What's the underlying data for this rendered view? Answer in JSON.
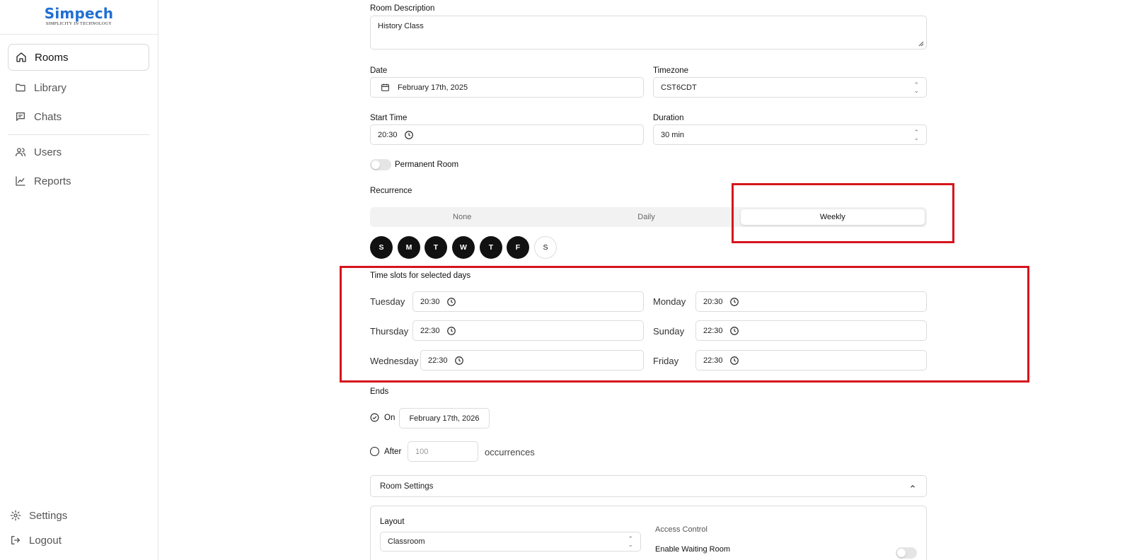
{
  "brand": {
    "name": "Simpech",
    "tagline": "SIMPLICITY IN TECHNOLOGY"
  },
  "sidebar": {
    "items": [
      {
        "label": "Rooms",
        "icon": "home-icon",
        "active": true
      },
      {
        "label": "Library",
        "icon": "folder-icon"
      },
      {
        "label": "Chats",
        "icon": "chat-icon"
      },
      {
        "label": "Users",
        "icon": "users-icon"
      },
      {
        "label": "Reports",
        "icon": "chart-line-icon"
      }
    ],
    "bottom": [
      {
        "label": "Settings",
        "icon": "gear-icon"
      },
      {
        "label": "Logout",
        "icon": "logout-icon"
      }
    ]
  },
  "form": {
    "description": {
      "label": "Room Description",
      "value": "History Class"
    },
    "date": {
      "label": "Date",
      "value": "February 17th, 2025"
    },
    "timezone": {
      "label": "Timezone",
      "value": "CST6CDT"
    },
    "start_time": {
      "label": "Start Time",
      "value": "20:30"
    },
    "duration": {
      "label": "Duration",
      "value": "30 min"
    },
    "permanent": {
      "label": "Permanent Room",
      "on": false
    },
    "recurrence": {
      "label": "Recurrence",
      "options": [
        "None",
        "Daily",
        "Weekly"
      ],
      "selected": "Weekly"
    },
    "days": [
      {
        "letter": "S",
        "selected": true
      },
      {
        "letter": "M",
        "selected": true
      },
      {
        "letter": "T",
        "selected": true
      },
      {
        "letter": "W",
        "selected": true
      },
      {
        "letter": "T",
        "selected": true
      },
      {
        "letter": "F",
        "selected": true
      },
      {
        "letter": "S",
        "selected": false
      }
    ],
    "time_slots": {
      "label": "Time slots for selected days",
      "left": [
        {
          "day": "Tuesday",
          "time": "20:30"
        },
        {
          "day": "Thursday",
          "time": "22:30"
        },
        {
          "day": "Wednesday",
          "time": "22:30"
        }
      ],
      "right": [
        {
          "day": "Monday",
          "time": "20:30"
        },
        {
          "day": "Sunday",
          "time": "22:30"
        },
        {
          "day": "Friday",
          "time": "22:30"
        }
      ]
    },
    "ends": {
      "label": "Ends",
      "on_label": "On",
      "on_date": "February 17th, 2026",
      "after_label": "After",
      "after_placeholder": "100",
      "occurrences_label": "occurrences",
      "selected": "on"
    },
    "room_settings": {
      "label": "Room Settings",
      "layout_label": "Layout",
      "layout_value": "Classroom",
      "access_label": "Access Control",
      "waiting_room_label": "Enable Waiting Room"
    }
  },
  "colors": {
    "brand": "#1f6fd1",
    "highlight": "#d6141c",
    "selected_day": "#111111"
  }
}
